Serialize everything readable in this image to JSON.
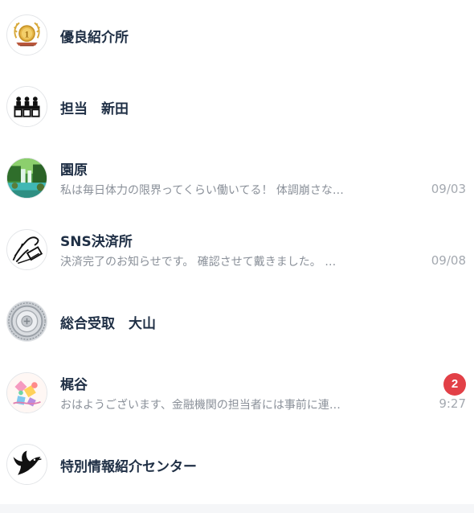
{
  "chats": [
    {
      "name": "優良紹介所",
      "icon": "award-medal-icon"
    },
    {
      "name": "担当　新田",
      "icon": "office-desk-icon"
    },
    {
      "name": "園原",
      "preview": "私は毎日体力の限界ってくらい働いてる！ 体調崩さな…",
      "time": "09/03",
      "icon": "forest-waterfall-photo"
    },
    {
      "name": "SNS決済所",
      "preview": "決済完了のお知らせです。 確認させて戴きました。 …",
      "time": "09/08",
      "icon": "hand-with-phone-icon"
    },
    {
      "name": "総合受取　大山",
      "icon": "coin-stack-photo"
    },
    {
      "name": "梶谷",
      "preview": "おはようございます、金融機関の担当者には事前に連…",
      "time": "9:27",
      "unread": "2",
      "icon": "colorful-illustration-photo"
    },
    {
      "name": "特別情報紹介センター",
      "icon": "dove-icon"
    }
  ],
  "colors": {
    "name": "#1f2f45",
    "preview": "#8a9099",
    "time": "#a4a9b0",
    "badge": "#e24047"
  }
}
